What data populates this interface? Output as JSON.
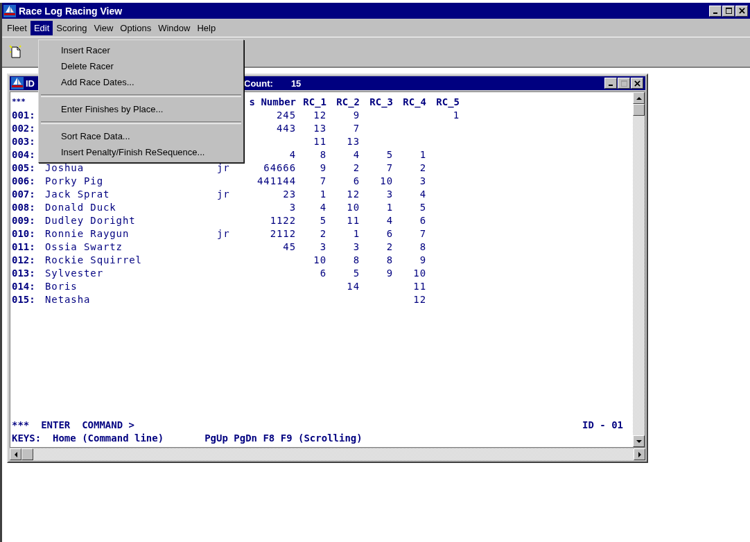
{
  "window": {
    "title": "Race Log Racing View"
  },
  "menu_bar": [
    {
      "label": "Fleet",
      "selected": false
    },
    {
      "label": "Edit",
      "selected": true
    },
    {
      "label": "Scoring",
      "selected": false
    },
    {
      "label": "View",
      "selected": false
    },
    {
      "label": "Options",
      "selected": false
    },
    {
      "label": "Window",
      "selected": false
    },
    {
      "label": "Help",
      "selected": false
    }
  ],
  "edit_menu": [
    {
      "kind": "item",
      "label": "Insert Racer"
    },
    {
      "kind": "item",
      "label": "Delete Racer"
    },
    {
      "kind": "item",
      "label": "Add Race Dates..."
    },
    {
      "kind": "separator"
    },
    {
      "kind": "item",
      "label": "Enter Finishes by Place..."
    },
    {
      "kind": "separator"
    },
    {
      "kind": "item",
      "label": "Sort Race Data..."
    },
    {
      "kind": "item",
      "label": "Insert Penalty/Finish ReSequence..."
    }
  ],
  "child_window": {
    "title_left": "ID",
    "title_right": "Count:",
    "count": "15",
    "columns": {
      "id": "***",
      "number": "s Number",
      "rc_1": "RC_1",
      "rc_2": "RC_2",
      "rc_3": "RC_3",
      "rc_4": "RC_4",
      "rc_5": "RC_5"
    },
    "rows": [
      {
        "id": "001:",
        "number": "245",
        "rc_1": "12",
        "rc_2": "9",
        "rc_5": "1"
      },
      {
        "id": "002:",
        "number": "443",
        "rc_1": "13",
        "rc_2": "7"
      },
      {
        "id": "003:",
        "rc_1": "11",
        "rc_2": "13"
      },
      {
        "id": "004:",
        "number": "4",
        "rc_1": "8",
        "rc_2": "4",
        "rc_3": "5",
        "rc_4": "1"
      },
      {
        "id": "005:",
        "name": "Joshua",
        "tag": "jr",
        "number": "64666",
        "rc_1": "9",
        "rc_2": "2",
        "rc_3": "7",
        "rc_4": "2"
      },
      {
        "id": "006:",
        "name": "Porky Pig",
        "number": "441144",
        "rc_1": "7",
        "rc_2": "6",
        "rc_3": "10",
        "rc_4": "3"
      },
      {
        "id": "007:",
        "name": "Jack Sprat",
        "tag": "jr",
        "number": "23",
        "rc_1": "1",
        "rc_2": "12",
        "rc_3": "3",
        "rc_4": "4"
      },
      {
        "id": "008:",
        "name": "Donald Duck",
        "number": "3",
        "rc_1": "4",
        "rc_2": "10",
        "rc_3": "1",
        "rc_4": "5"
      },
      {
        "id": "009:",
        "name": "Dudley Doright",
        "number": "1122",
        "rc_1": "5",
        "rc_2": "11",
        "rc_3": "4",
        "rc_4": "6"
      },
      {
        "id": "010:",
        "name": "Ronnie Raygun",
        "tag": "jr",
        "number": "2112",
        "rc_1": "2",
        "rc_2": "1",
        "rc_3": "6",
        "rc_4": "7"
      },
      {
        "id": "011:",
        "name": "Ossia Swartz",
        "number": "45",
        "rc_1": "3",
        "rc_2": "3",
        "rc_3": "2",
        "rc_4": "8"
      },
      {
        "id": "012:",
        "name": "Rockie Squirrel",
        "rc_1": "10",
        "rc_2": "8",
        "rc_3": "8",
        "rc_4": "9"
      },
      {
        "id": "013:",
        "name": "Sylvester",
        "rc_1": "6",
        "rc_2": "5",
        "rc_3": "9",
        "rc_4": "10"
      },
      {
        "id": "014:",
        "name": "Boris",
        "rc_2": "14",
        "rc_4": "11"
      },
      {
        "id": "015:",
        "name": "Netasha",
        "rc_4": "12"
      }
    ],
    "command_line": {
      "prompt": "***  ENTER  COMMAND >",
      "id": "ID - 01"
    },
    "keys_line": {
      "home": "KEYS:  Home (Command line)",
      "scrolling": "PgUp PgDn F8 F9 (Scrolling)"
    }
  }
}
